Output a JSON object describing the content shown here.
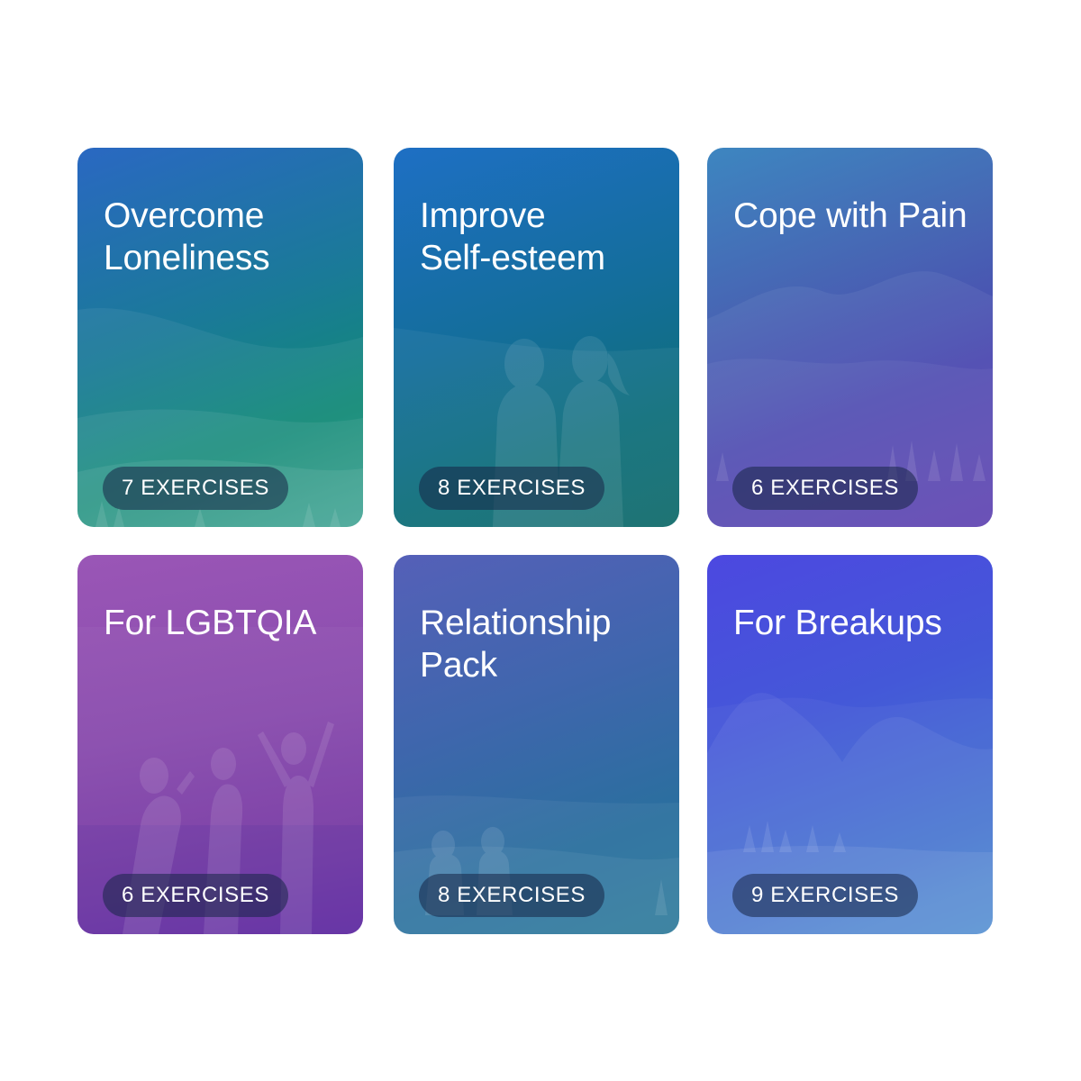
{
  "cards": [
    {
      "title": "Overcome\nLoneliness",
      "badge": "7 EXERCISES"
    },
    {
      "title": "Improve\nSelf-esteem",
      "badge": "8 EXERCISES"
    },
    {
      "title": "Cope with Pain",
      "badge": "6 EXERCISES"
    },
    {
      "title": "For LGBTQIA",
      "badge": "6 EXERCISES"
    },
    {
      "title": "Relationship\nPack",
      "badge": "8 EXERCISES"
    },
    {
      "title": "For Breakups",
      "badge": "9 EXERCISES"
    }
  ],
  "illustrations": [
    "hills-landscape-illustration",
    "two-people-silhouette-illustration",
    "mountains-forest-illustration",
    "celebrating-people-silhouette-illustration",
    "couple-on-hill-illustration",
    "mountains-lake-illustration"
  ]
}
